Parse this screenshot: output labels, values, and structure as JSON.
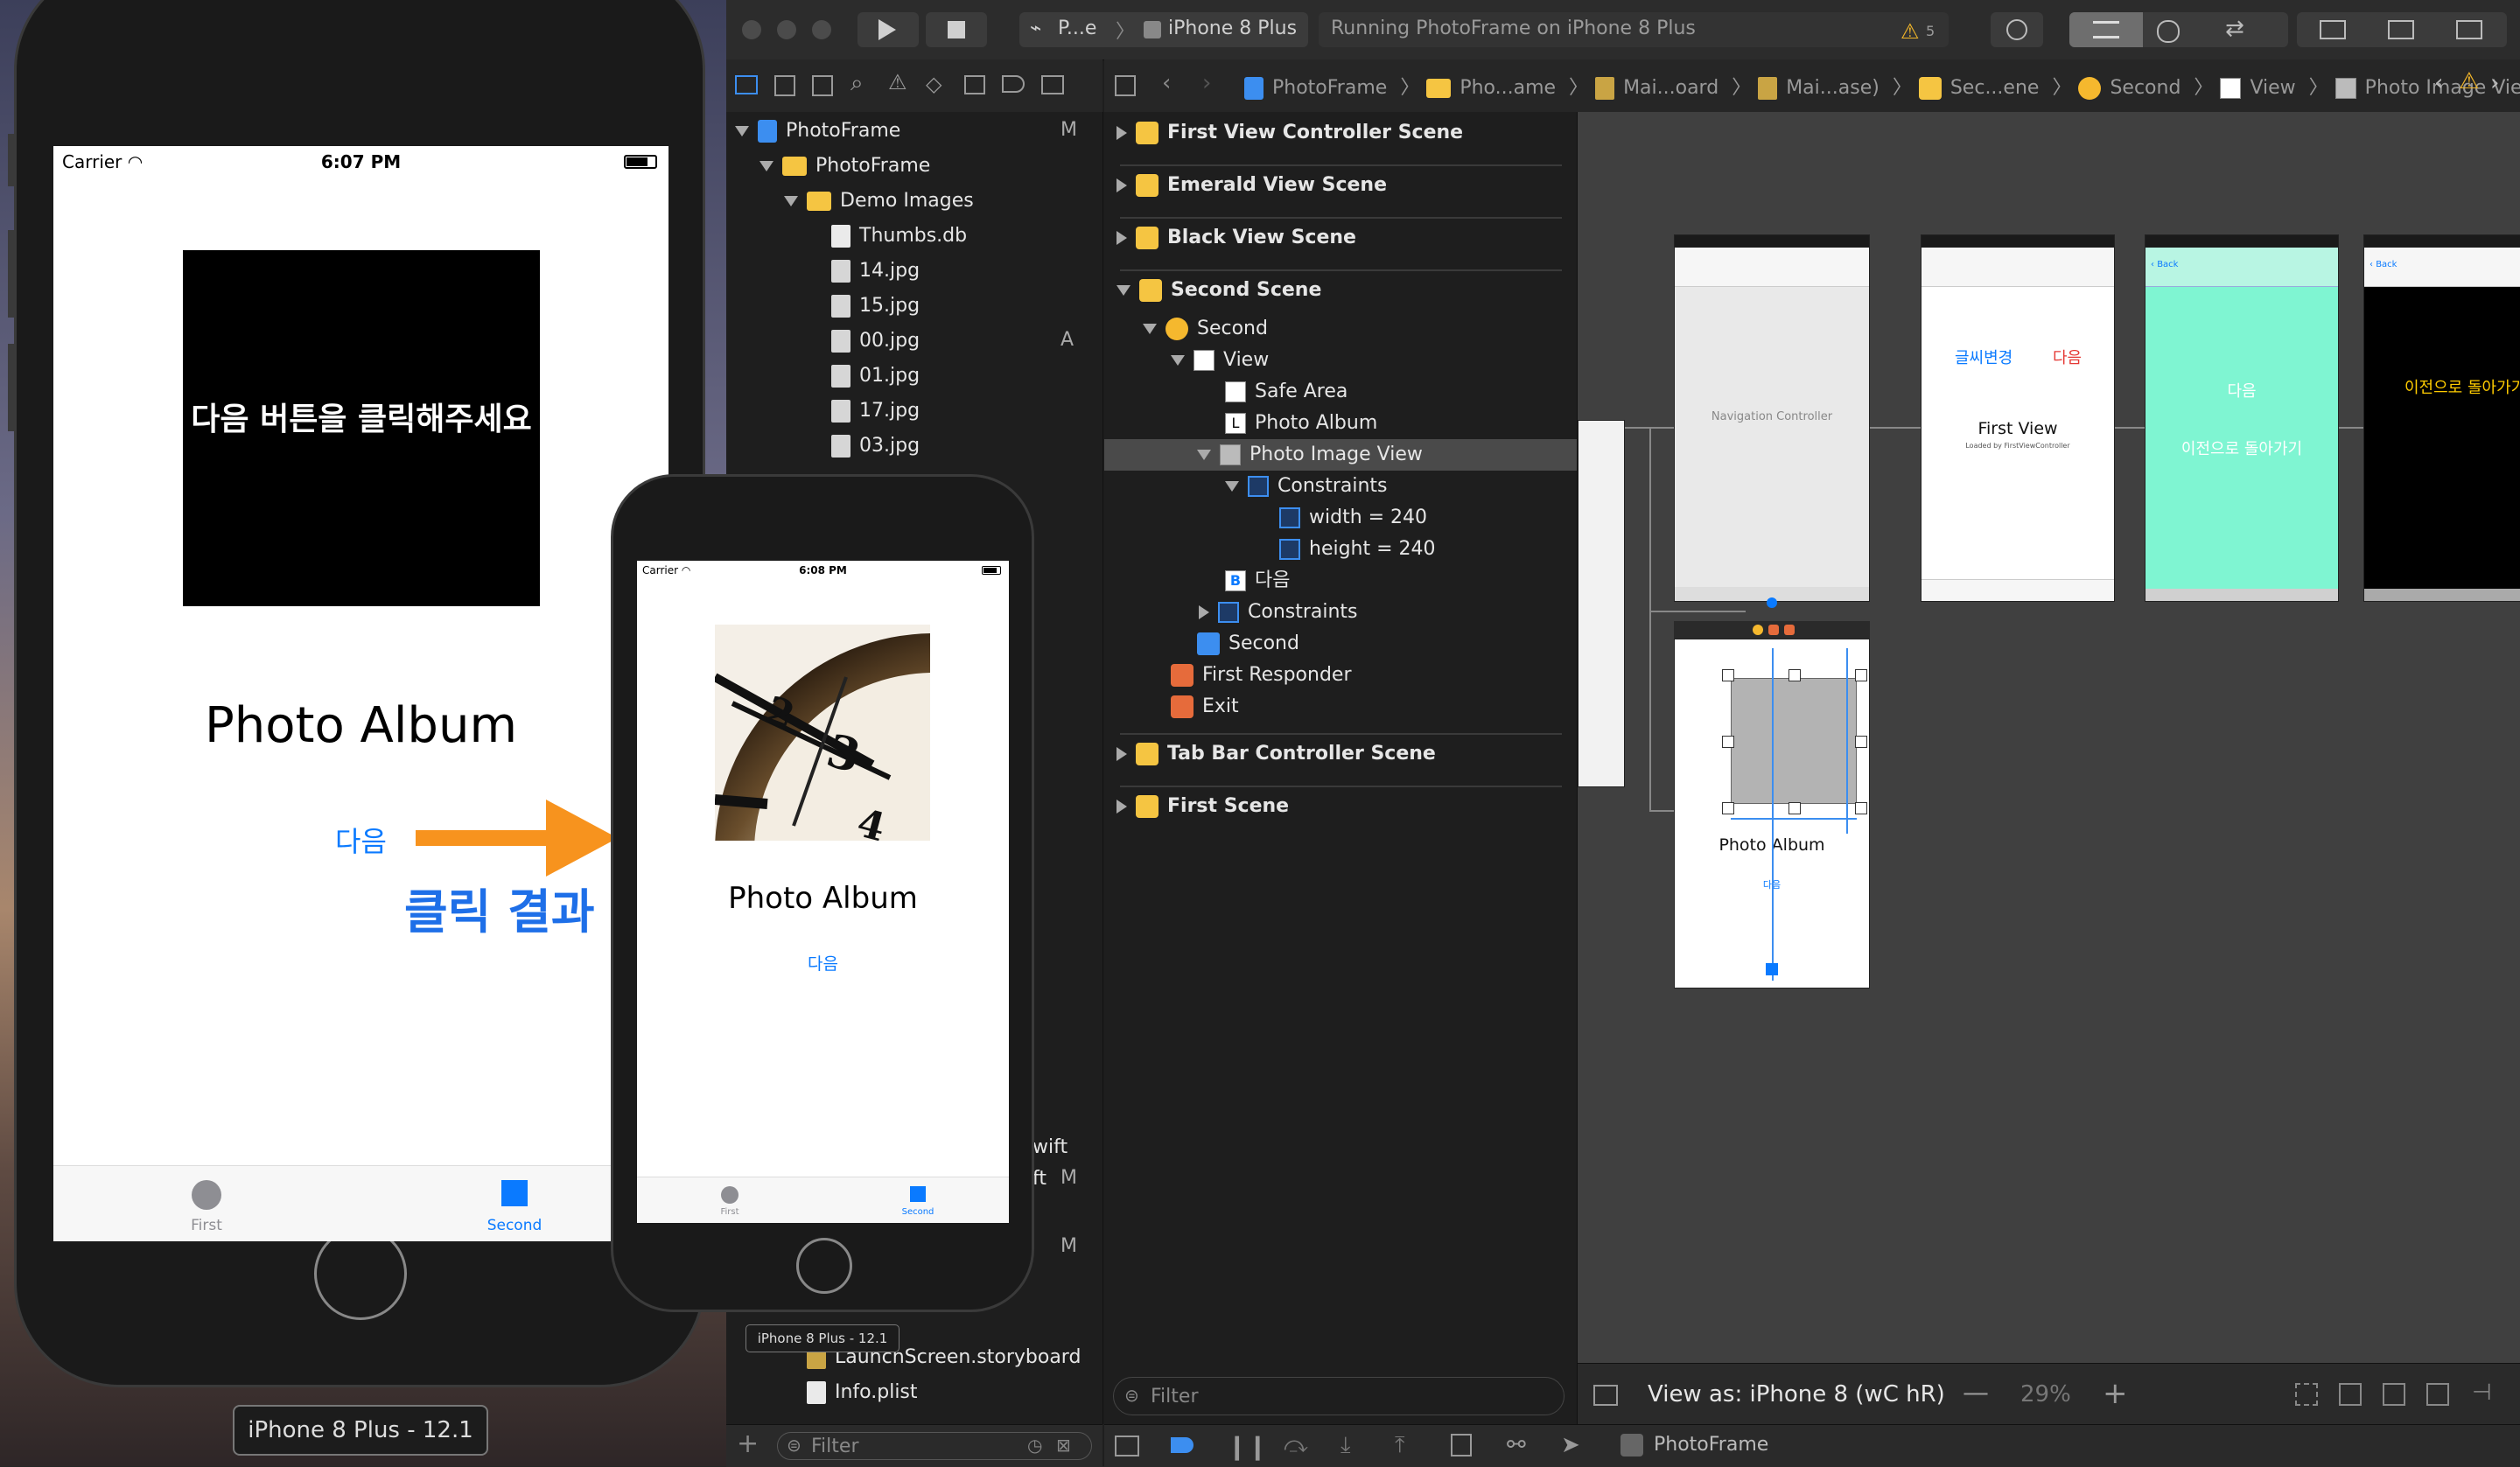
{
  "toolbar": {
    "scheme_app": "P...e",
    "scheme_device": "iPhone 8 Plus",
    "activity": "Running PhotoFrame on iPhone 8 Plus",
    "warning_count": "5"
  },
  "jumpbar": {
    "crumbs": [
      "PhotoFrame",
      "Pho...ame",
      "Mai...oard",
      "Mai...ase)",
      "Sec...ene",
      "Second",
      "View",
      "Photo Image View"
    ]
  },
  "navigator": {
    "items": [
      {
        "label": "PhotoFrame",
        "badge": "M"
      },
      {
        "label": "PhotoFrame",
        "badge": ""
      },
      {
        "label": "Demo Images",
        "badge": ""
      },
      {
        "label": "Thumbs.db",
        "badge": ""
      },
      {
        "label": "14.jpg",
        "badge": ""
      },
      {
        "label": "15.jpg",
        "badge": ""
      },
      {
        "label": "00.jpg",
        "badge": "A"
      },
      {
        "label": "01.jpg",
        "badge": ""
      },
      {
        "label": "17.jpg",
        "badge": ""
      },
      {
        "label": "03.jpg",
        "badge": ""
      }
    ],
    "partial_swift_1": "wift",
    "partial_swift_2": "ft",
    "partial_badge_1": "M",
    "partial_badge_2": "M",
    "launch": "LaunchScreen.storyboard",
    "info": "Info.plist",
    "filter_placeholder": "Filter"
  },
  "outline": {
    "rows": [
      "First View Controller Scene",
      "Emerald View Scene",
      "Black View Scene",
      "Second Scene",
      "Second",
      "View",
      "Safe Area",
      "Photo Album",
      "Photo Image View",
      "Constraints",
      "width = 240",
      "height = 240",
      "다음",
      "Constraints",
      "Second",
      "First Responder",
      "Exit",
      "Tab Bar Controller Scene",
      "First Scene"
    ],
    "filter_placeholder": "Filter"
  },
  "canvas": {
    "view_as": "View as: iPhone 8 (wC hR)",
    "zoom": "29%",
    "nav_controller": "Navigation Controller",
    "first_vc_title": "First View",
    "first_vc_sub": "Loaded by FirstViewController",
    "first_vc_btn1": "글씨변경",
    "first_vc_btn2": "다음",
    "emerald_btn1": "다음",
    "emerald_btn2": "이전으로 돌아가기",
    "black_btn": "이전으로 돌아가기",
    "second_label": "Photo Album",
    "second_btn": "다음",
    "back": "Back"
  },
  "bottombar": {
    "scheme_label": "PhotoFrame"
  },
  "sim_large": {
    "carrier": "Carrier",
    "time": "6:07 PM",
    "prompt": "다음 버튼을 클릭해주세요",
    "title": "Photo Album",
    "next": "다음",
    "tab_first": "First",
    "tab_second": "Second",
    "device_label": "iPhone 8 Plus - 12.1"
  },
  "annotation": {
    "click_result": "클릭 결과",
    "arrow_color": "#f7931e"
  },
  "sim_small": {
    "carrier": "Carrier",
    "time": "6:08 PM",
    "title": "Photo Album",
    "next": "다음",
    "tab_first": "First",
    "tab_second": "Second",
    "device_label": "iPhone 8 Plus - 12.1"
  }
}
